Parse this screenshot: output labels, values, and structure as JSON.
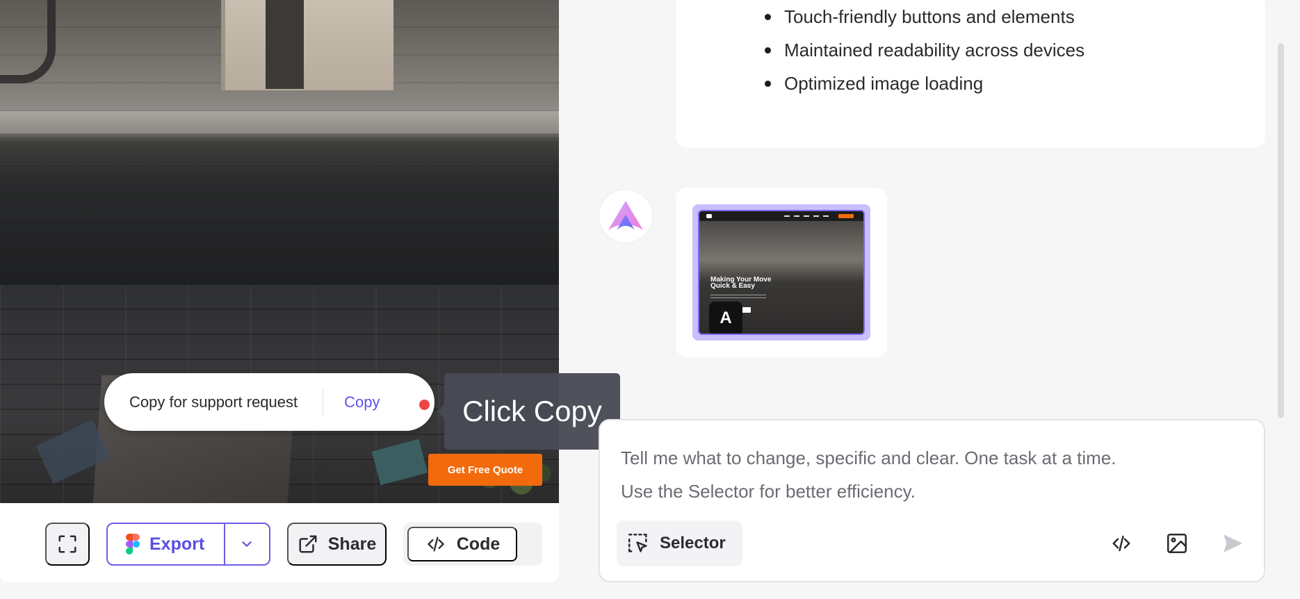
{
  "preview": {
    "cta_label": "Get Free Quote",
    "copy_popup": {
      "label": "Copy for support request",
      "copy_link": "Copy"
    },
    "tooltip": "Click Copy",
    "toolbar": {
      "export_label": "Export",
      "share_label": "Share",
      "code_label": "Code"
    }
  },
  "chat": {
    "bullets": [
      "Touch-friendly buttons and elements",
      "Maintained readability across devices",
      "Optimized image loading"
    ],
    "thumbnail": {
      "headline_line1": "Making Your Move",
      "headline_line2": "Quick & Easy",
      "badge": "A"
    },
    "composer": {
      "placeholder_line1": "Tell me what to change, specific and clear. One task at a time.",
      "placeholder_line2": "Use the Selector for better efficiency.",
      "selector_label": "Selector"
    }
  },
  "colors": {
    "accent": "#5b4ee0",
    "cta": "#f36a0d",
    "tooltip_bg": "#484a54",
    "pointer_dot": "#ef4444"
  },
  "icons": [
    "fullscreen-icon",
    "figma-icon",
    "chevron-down-icon",
    "external-link-icon",
    "code-icon",
    "app-logo-icon",
    "selector-icon",
    "image-icon",
    "send-icon"
  ]
}
